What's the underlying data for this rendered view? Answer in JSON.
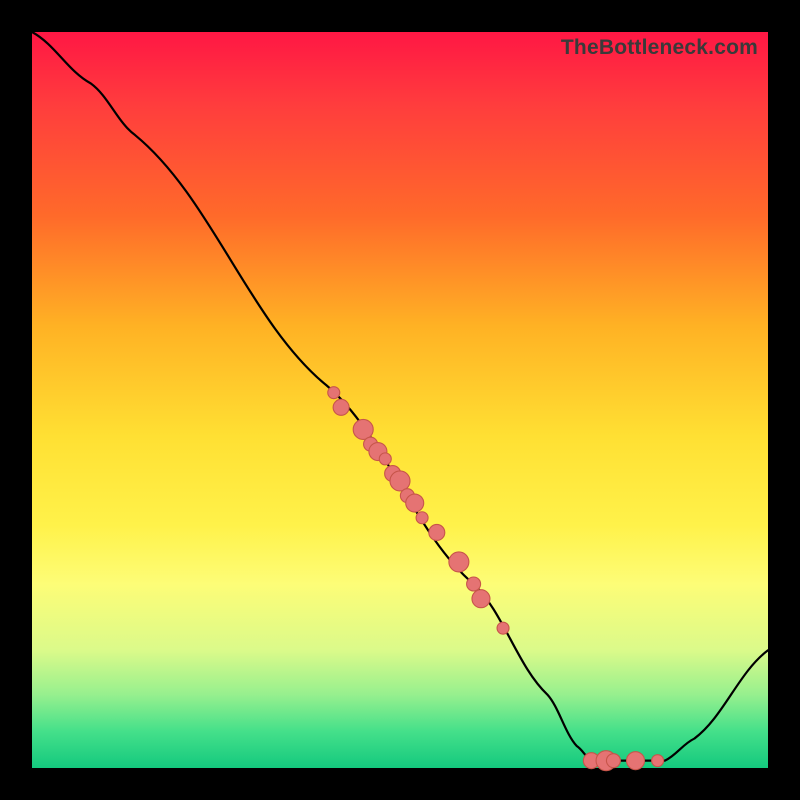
{
  "watermark": "TheBottleneck.com",
  "chart_data": {
    "type": "line",
    "title": "",
    "xlabel": "",
    "ylabel": "",
    "xlim": [
      0,
      100
    ],
    "ylim": [
      0,
      100
    ],
    "curve": [
      {
        "x": 0,
        "y": 100
      },
      {
        "x": 8,
        "y": 93
      },
      {
        "x": 14,
        "y": 86
      },
      {
        "x": 40,
        "y": 52
      },
      {
        "x": 60,
        "y": 25
      },
      {
        "x": 70,
        "y": 10
      },
      {
        "x": 74,
        "y": 3
      },
      {
        "x": 76,
        "y": 1
      },
      {
        "x": 86,
        "y": 1
      },
      {
        "x": 90,
        "y": 4
      },
      {
        "x": 100,
        "y": 16
      }
    ],
    "scatter": [
      {
        "x": 41,
        "y": 51
      },
      {
        "x": 42,
        "y": 49
      },
      {
        "x": 45,
        "y": 46
      },
      {
        "x": 46,
        "y": 44
      },
      {
        "x": 47,
        "y": 43
      },
      {
        "x": 48,
        "y": 42
      },
      {
        "x": 49,
        "y": 40
      },
      {
        "x": 50,
        "y": 39
      },
      {
        "x": 51,
        "y": 37
      },
      {
        "x": 52,
        "y": 36
      },
      {
        "x": 53,
        "y": 34
      },
      {
        "x": 55,
        "y": 32
      },
      {
        "x": 58,
        "y": 28
      },
      {
        "x": 60,
        "y": 25
      },
      {
        "x": 61,
        "y": 23
      },
      {
        "x": 64,
        "y": 19
      },
      {
        "x": 76,
        "y": 1
      },
      {
        "x": 78,
        "y": 1
      },
      {
        "x": 79,
        "y": 1
      },
      {
        "x": 82,
        "y": 1
      },
      {
        "x": 85,
        "y": 1
      }
    ]
  }
}
